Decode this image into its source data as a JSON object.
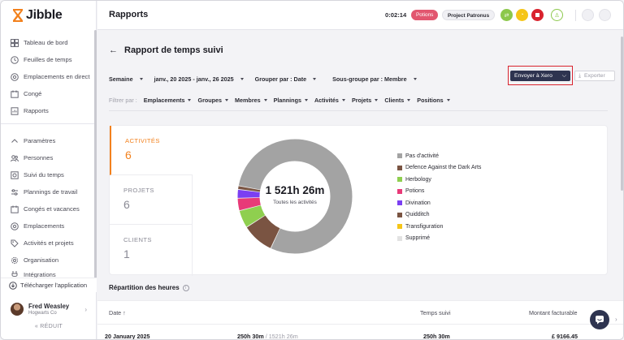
{
  "app": {
    "name": "Jibble",
    "brand_color": "#f2811d"
  },
  "sidebar": {
    "items_top": [
      {
        "label": "Tableau de bord",
        "icon": "dashboard-icon"
      },
      {
        "label": "Feuilles de temps",
        "icon": "clock-icon"
      },
      {
        "label": "Emplacements en direct",
        "icon": "location-icon"
      },
      {
        "label": "Congé",
        "icon": "calendar-icon"
      },
      {
        "label": "Rapports",
        "icon": "report-icon"
      }
    ],
    "items_bottom": [
      {
        "label": "Paramètres",
        "icon": "chevron-up-icon"
      },
      {
        "label": "Personnes",
        "icon": "people-icon"
      },
      {
        "label": "Suivi du temps",
        "icon": "time-tracking-icon"
      },
      {
        "label": "Plannings de travail",
        "icon": "schedule-icon"
      },
      {
        "label": "Congés et vacances",
        "icon": "calendar-icon"
      },
      {
        "label": "Emplacements",
        "icon": "location-icon"
      },
      {
        "label": "Activités et projets",
        "icon": "tag-icon"
      },
      {
        "label": "Organisation",
        "icon": "gear-icon"
      },
      {
        "label": "Intégrations",
        "icon": "plug-icon"
      }
    ],
    "download_label": "Télécharger l'application",
    "user": {
      "name": "Fred Weasley",
      "org": "Hogwarts Co"
    },
    "collapse_label": "« RÉDUIT"
  },
  "topbar": {
    "title": "Rapports",
    "timer": "0:02:14",
    "activity_tag": "Potions",
    "project_tag": "Project Patronus"
  },
  "report": {
    "title": "Rapport de temps suivi",
    "period_type": "Semaine",
    "date_range": "janv., 20 2025 - janv., 26 2025",
    "group_by": "Grouper par : Date",
    "subgroup_by": "Sous-groupe par : Membre",
    "xero_label": "Envoyer à Xero",
    "export_label": "Exporter",
    "filter_label": "Filtrer par :",
    "filters": [
      "Emplacements",
      "Groupes",
      "Membres",
      "Plannings",
      "Activités",
      "Projets",
      "Clients",
      "Positions"
    ]
  },
  "tabs": [
    {
      "label": "ACTIVITÉS",
      "count": "6",
      "active": true
    },
    {
      "label": "PROJETS",
      "count": "6",
      "active": false
    },
    {
      "label": "CLIENTS",
      "count": "1",
      "active": false
    }
  ],
  "chart_data": {
    "type": "pie",
    "center_value": "1 521h 26m",
    "center_label": "Toutes les activités",
    "series": [
      {
        "name": "Pas d'activité",
        "value": 79,
        "color": "#a3a3a3"
      },
      {
        "name": "Defence Against the Dark Arts",
        "value": 9,
        "color": "#7a5442"
      },
      {
        "name": "Herbology",
        "value": 5,
        "color": "#8fcf4f"
      },
      {
        "name": "Potions",
        "value": 3.5,
        "color": "#e83a78"
      },
      {
        "name": "Divination",
        "value": 2.5,
        "color": "#7b3ff2"
      },
      {
        "name": "Quidditch",
        "value": 1,
        "color": "#7a5442"
      },
      {
        "name": "Transfiguration",
        "value": 0,
        "color": "#f5c518"
      },
      {
        "name": "Supprimé",
        "value": 0,
        "color": "#e2e2e2"
      }
    ]
  },
  "breakdown": {
    "title": "Répartition des heures",
    "columns": {
      "date": "Date ↑",
      "tracked": "Temps suivi",
      "billable": "Montant facturable"
    },
    "row": {
      "date": "20 January 2025",
      "bar_text": "250h 30m",
      "bar_sub": "/ 1521h 26m",
      "tracked": "250h 30m",
      "billable": "£ 9166.45"
    }
  }
}
